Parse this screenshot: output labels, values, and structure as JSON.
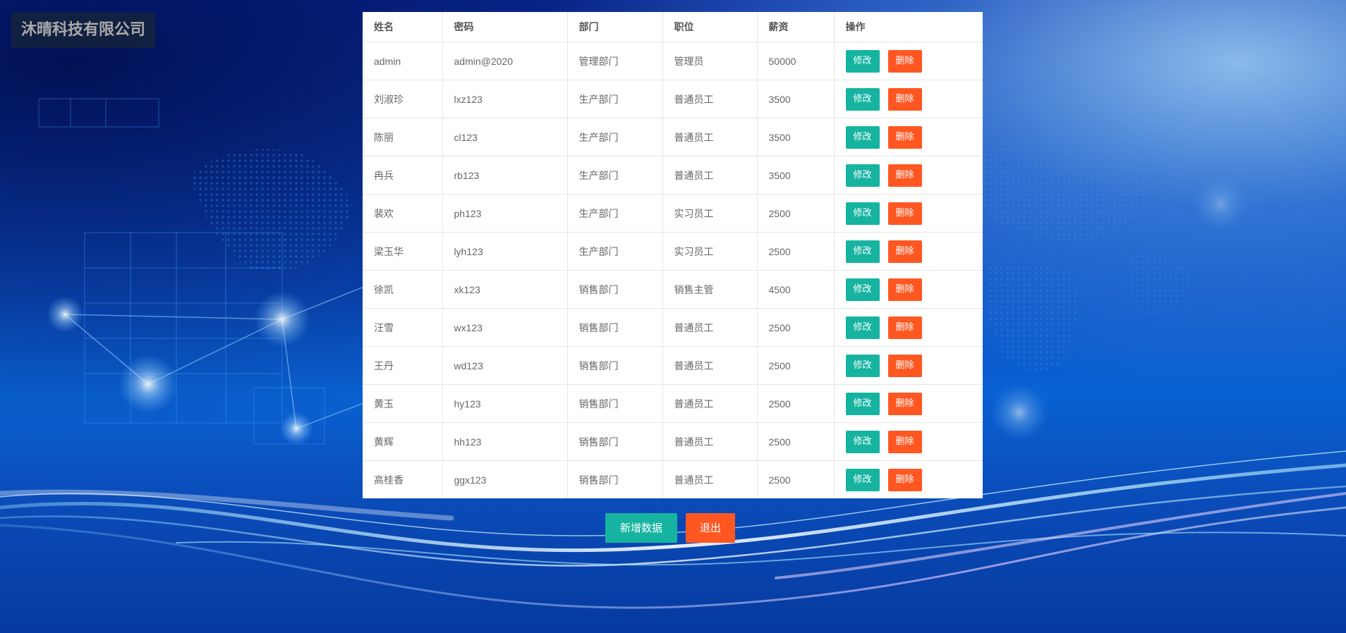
{
  "logo": {
    "text": "沐晴科技有限公司"
  },
  "table": {
    "headers": [
      "姓名",
      "密码",
      "部门",
      "职位",
      "薪资",
      "操作"
    ],
    "rows": [
      {
        "name": "admin",
        "password": "admin@2020",
        "dept": "管理部门",
        "position": "管理员",
        "salary": "50000"
      },
      {
        "name": "刘淑珍",
        "password": "lxz123",
        "dept": "生产部门",
        "position": "普通员工",
        "salary": "3500"
      },
      {
        "name": "陈丽",
        "password": "cl123",
        "dept": "生产部门",
        "position": "普通员工",
        "salary": "3500"
      },
      {
        "name": "冉兵",
        "password": "rb123",
        "dept": "生产部门",
        "position": "普通员工",
        "salary": "3500"
      },
      {
        "name": "裴欢",
        "password": "ph123",
        "dept": "生产部门",
        "position": "实习员工",
        "salary": "2500"
      },
      {
        "name": "梁玉华",
        "password": "lyh123",
        "dept": "生产部门",
        "position": "实习员工",
        "salary": "2500"
      },
      {
        "name": "徐凯",
        "password": "xk123",
        "dept": "销售部门",
        "position": "销售主管",
        "salary": "4500"
      },
      {
        "name": "汪雪",
        "password": "wx123",
        "dept": "销售部门",
        "position": "普通员工",
        "salary": "2500"
      },
      {
        "name": "王丹",
        "password": "wd123",
        "dept": "销售部门",
        "position": "普通员工",
        "salary": "2500"
      },
      {
        "name": "黄玉",
        "password": "hy123",
        "dept": "销售部门",
        "position": "普通员工",
        "salary": "2500"
      },
      {
        "name": "黄辉",
        "password": "hh123",
        "dept": "销售部门",
        "position": "普通员工",
        "salary": "2500"
      },
      {
        "name": "高桂香",
        "password": "ggx123",
        "dept": "销售部门",
        "position": "普通员工",
        "salary": "2500"
      }
    ],
    "edit_label": "修改",
    "delete_label": "删除"
  },
  "actions": {
    "add_label": "新增数据",
    "exit_label": "退出"
  },
  "colors": {
    "edit_button": "#16b4a0",
    "delete_button": "#ff5722",
    "background_blue": "#0b4fc3"
  }
}
